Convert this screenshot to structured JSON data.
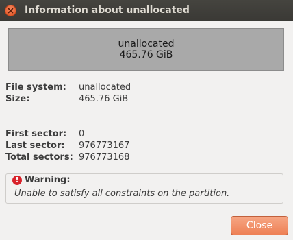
{
  "window": {
    "title": "Information about unallocated"
  },
  "partition_graphic": {
    "name": "unallocated",
    "size": "465.76 GiB",
    "fill_color": "#a9a9a9"
  },
  "details": {
    "file_system_label": "File system:",
    "file_system_value": "unallocated",
    "size_label": "Size:",
    "size_value": "465.76 GiB"
  },
  "sectors": {
    "first_label": "First sector:",
    "first_value": "0",
    "last_label": "Last sector:",
    "last_value": "976773167",
    "total_label": "Total sectors:",
    "total_value": "976773168"
  },
  "warning": {
    "title": "Warning:",
    "message": "Unable to satisfy all constraints on the partition.",
    "icon": "error-icon",
    "color": "#d8222a"
  },
  "buttons": {
    "close_label": "Close",
    "accent": "#ee8055"
  }
}
